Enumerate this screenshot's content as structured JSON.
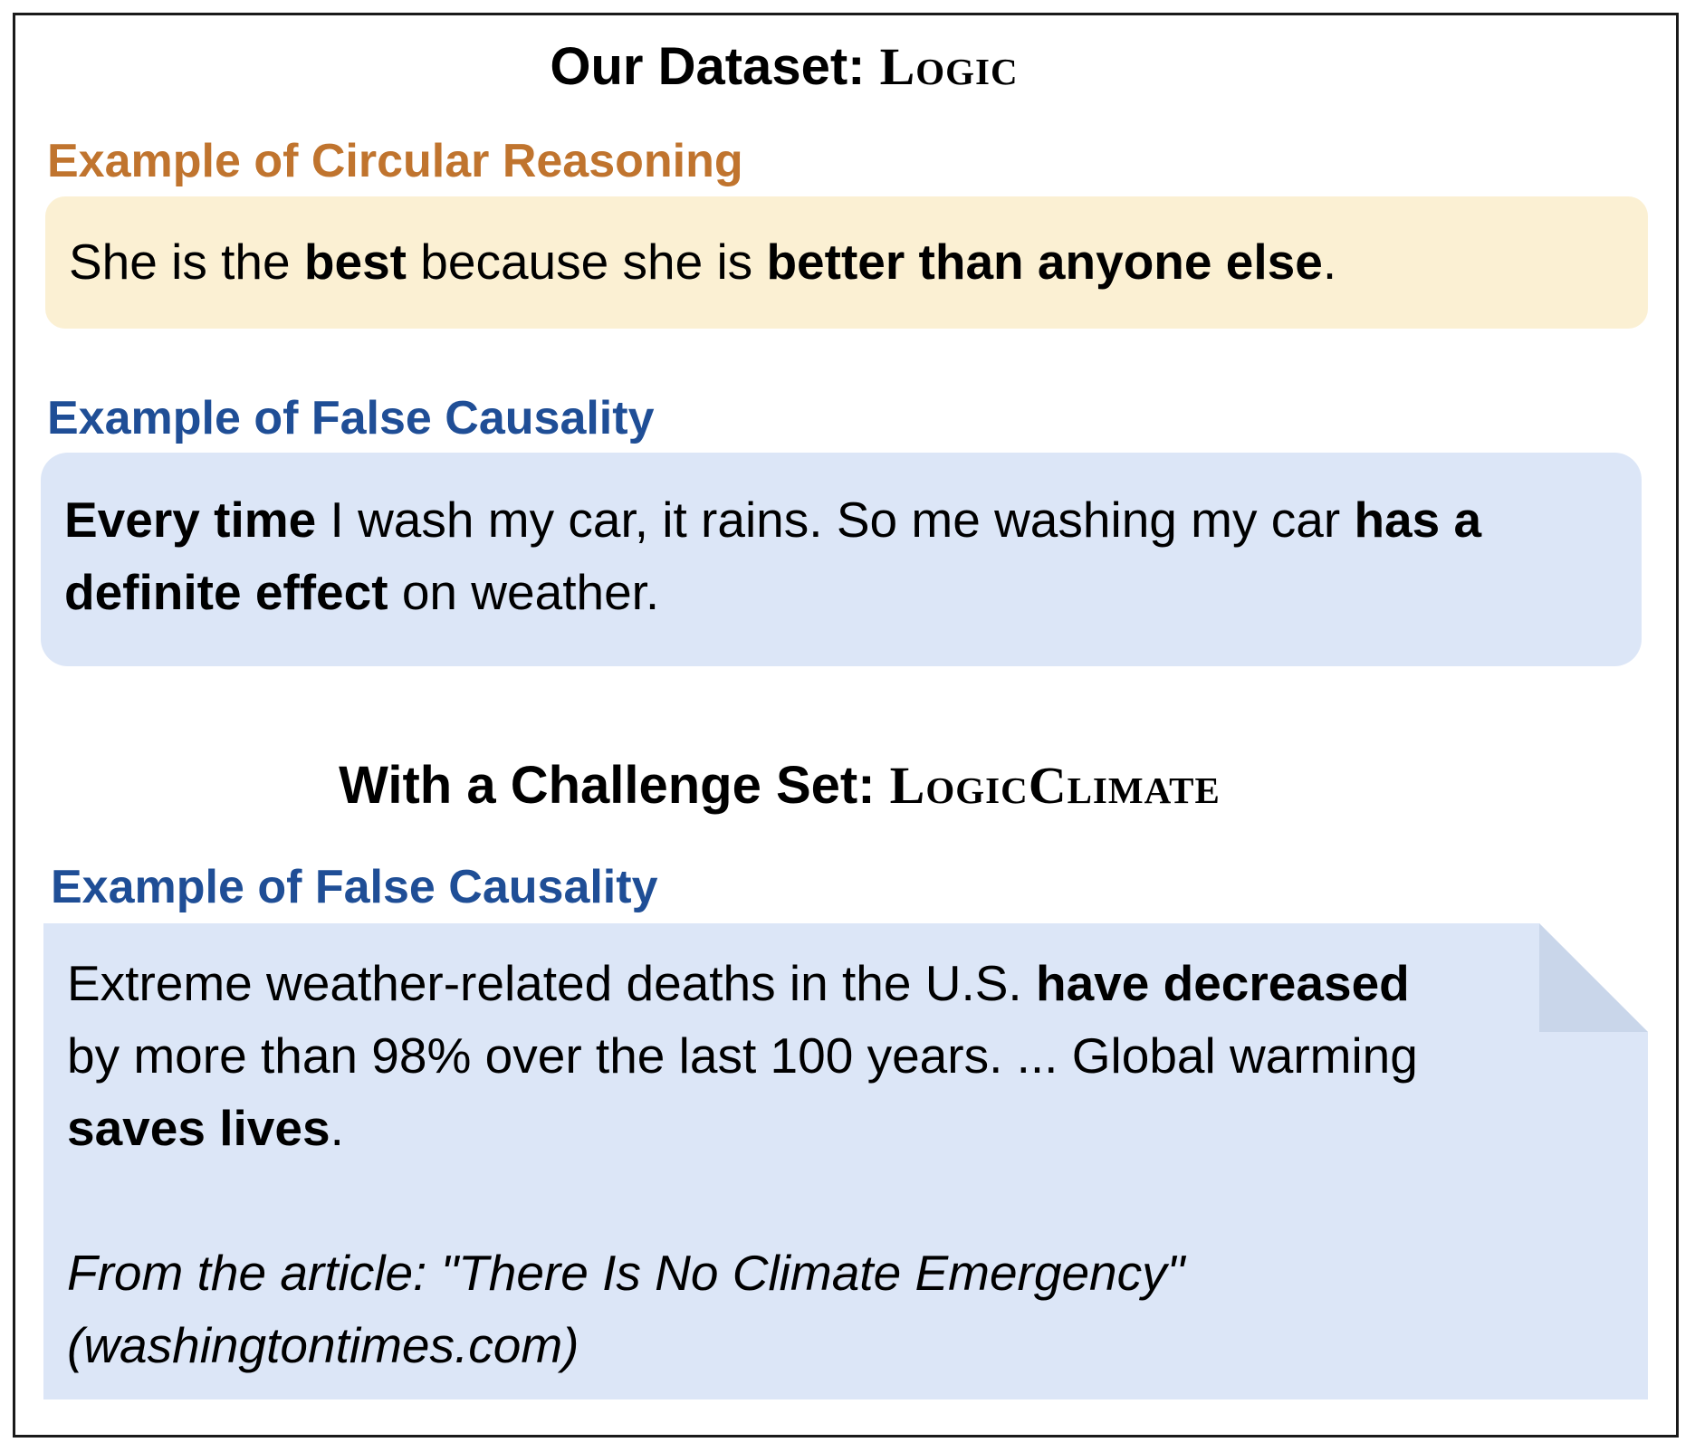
{
  "dataset_heading": {
    "prefix": "Our Dataset: ",
    "name": "Logic"
  },
  "example1": {
    "label": "Example of Circular Reasoning",
    "label_color": "#c0742e",
    "box_color": "#fbf0d3",
    "text": [
      {
        "t": "She is the ",
        "bold": false
      },
      {
        "t": "best",
        "bold": true
      },
      {
        "t": " because she is ",
        "bold": false
      },
      {
        "t": "better than anyone else",
        "bold": true
      },
      {
        "t": ".",
        "bold": false
      }
    ]
  },
  "example2": {
    "label": "Example of False Causality",
    "label_color": "#1f4e96",
    "box_color": "#dce6f7",
    "text": [
      {
        "t": "Every time",
        "bold": true
      },
      {
        "t": " I wash my car, it rains. So me washing my car ",
        "bold": false
      },
      {
        "t": "has a definite effect",
        "bold": true
      },
      {
        "t": " on weather.",
        "bold": false
      }
    ]
  },
  "challenge_heading": {
    "prefix": "With a Challenge Set: ",
    "name": "LogicClimate"
  },
  "example3": {
    "label": "Example of False Causality",
    "label_color": "#1f4e96",
    "box_color": "#dce6f7",
    "text": [
      {
        "t": "Extreme weather-related deaths in the U.S. ",
        "bold": false
      },
      {
        "t": "have decreased",
        "bold": true
      },
      {
        "t": " by more than 98% over the last 100 years. ... Global warming ",
        "bold": false
      },
      {
        "t": "saves lives",
        "bold": true
      },
      {
        "t": ".",
        "bold": false
      }
    ],
    "source_line1": "From the article: \"There Is No Climate Emergency\"",
    "source_line2": "(washingtontimes.com)"
  }
}
